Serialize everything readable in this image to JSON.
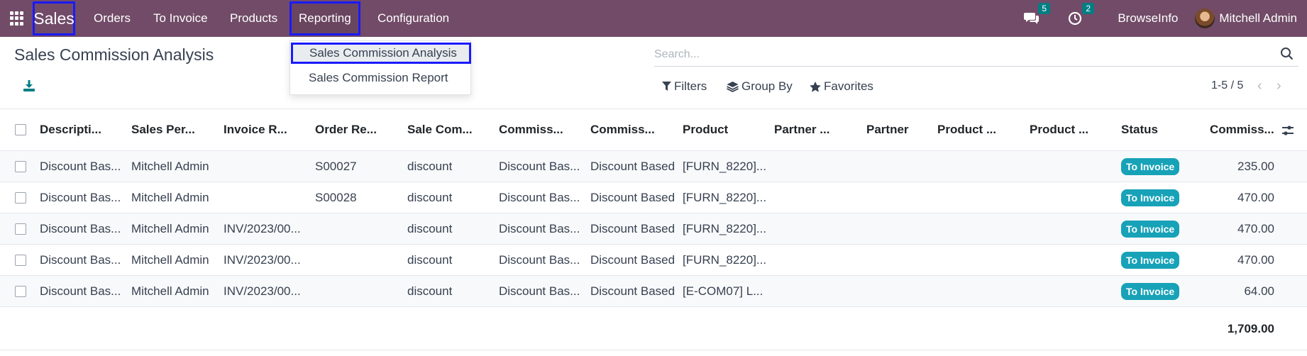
{
  "navbar": {
    "brand": "Sales",
    "menus": [
      "Orders",
      "To Invoice",
      "Products",
      "Reporting",
      "Configuration"
    ],
    "messages_count": "5",
    "activities_count": "2",
    "company": "BrowseInfo",
    "user": "Mitchell Admin",
    "color": "#714B67"
  },
  "reporting_menu": {
    "items": [
      "Sales Commission Analysis",
      "Sales Commission Report"
    ]
  },
  "page": {
    "title": "Sales Commission Analysis"
  },
  "search": {
    "placeholder": "Search...",
    "filters_label": "Filters",
    "group_by_label": "Group By",
    "favorites_label": "Favorites"
  },
  "pager": {
    "value": "1-5 / 5"
  },
  "table": {
    "columns": [
      "Descripti...",
      "Sales Per...",
      "Invoice R...",
      "Order Re...",
      "Sale Com...",
      "Commiss...",
      "Commiss...",
      "Product",
      "Partner ...",
      "Partner",
      "Product ...",
      "Product ...",
      "Status",
      "Commiss..."
    ],
    "rows": [
      {
        "description": "Discount Bas...",
        "salesperson": "Mitchell Admin",
        "invoice": "",
        "order": "S00027",
        "sale_com": "discount",
        "commiss1": "Discount Bas...",
        "commiss2": "Discount Based",
        "product": "[FURN_8220]...",
        "status": "To Invoice",
        "amount": "235.00"
      },
      {
        "description": "Discount Bas...",
        "salesperson": "Mitchell Admin",
        "invoice": "",
        "order": "S00028",
        "sale_com": "discount",
        "commiss1": "Discount Bas...",
        "commiss2": "Discount Based",
        "product": "[FURN_8220]...",
        "status": "To Invoice",
        "amount": "470.00"
      },
      {
        "description": "Discount Bas...",
        "salesperson": "Mitchell Admin",
        "invoice": "INV/2023/00...",
        "order": "",
        "sale_com": "discount",
        "commiss1": "Discount Bas...",
        "commiss2": "Discount Based",
        "product": "[FURN_8220]...",
        "status": "To Invoice",
        "amount": "470.00"
      },
      {
        "description": "Discount Bas...",
        "salesperson": "Mitchell Admin",
        "invoice": "INV/2023/00...",
        "order": "",
        "sale_com": "discount",
        "commiss1": "Discount Bas...",
        "commiss2": "Discount Based",
        "product": "[FURN_8220]...",
        "status": "To Invoice",
        "amount": "470.00"
      },
      {
        "description": "Discount Bas...",
        "salesperson": "Mitchell Admin",
        "invoice": "INV/2023/00...",
        "order": "",
        "sale_com": "discount",
        "commiss1": "Discount Bas...",
        "commiss2": "Discount Based",
        "product": "[E-COM07] L...",
        "status": "To Invoice",
        "amount": "64.00"
      }
    ],
    "total": "1,709.00",
    "status_color": "#17a2b8"
  }
}
